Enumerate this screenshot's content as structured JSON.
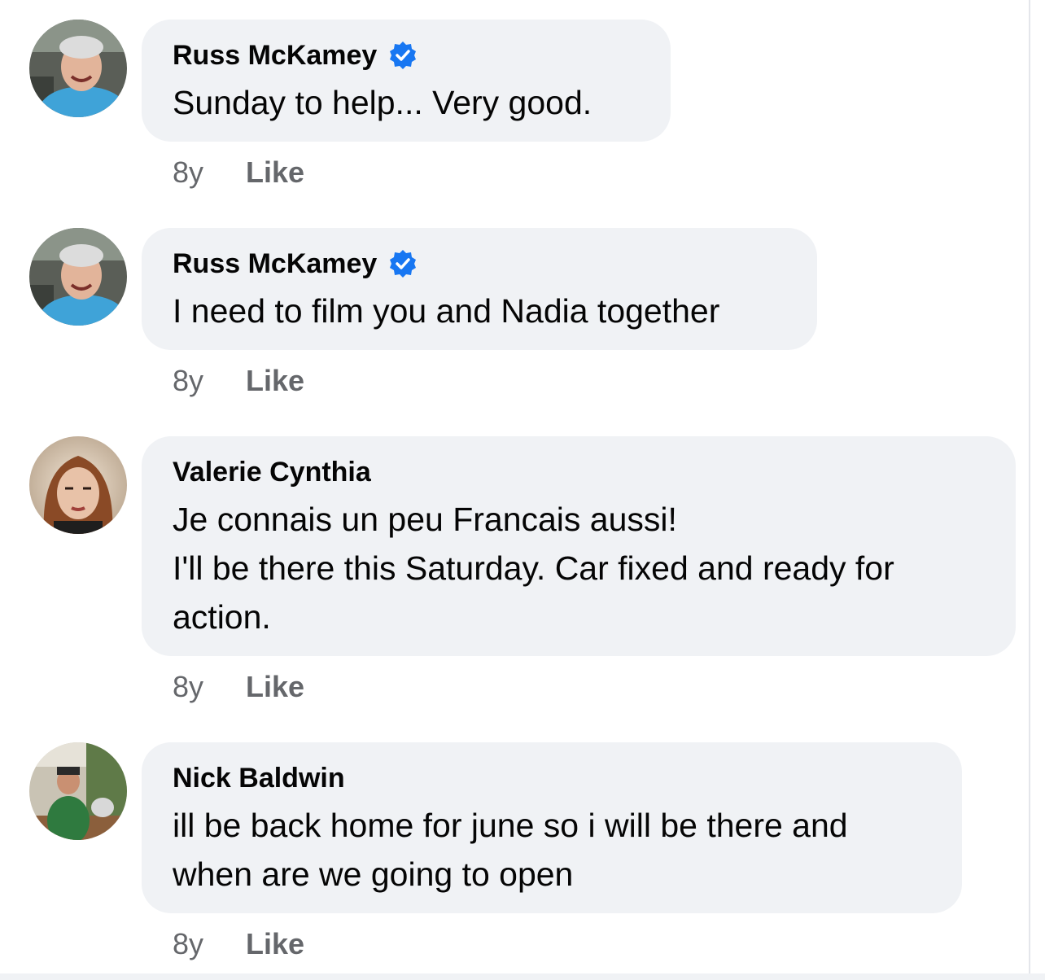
{
  "comments": [
    {
      "author": "Russ McKamey",
      "verified": true,
      "lines": [
        "Sunday to help... Very good."
      ],
      "age": "8y",
      "action": "Like"
    },
    {
      "author": "Russ McKamey",
      "verified": true,
      "lines": [
        "I need to film you and Nadia together"
      ],
      "age": "8y",
      "action": "Like"
    },
    {
      "author": "Valerie Cynthia",
      "verified": false,
      "lines": [
        "Je connais un peu Francais aussi!",
        "I'll be there this Saturday. Car fixed and ready for",
        "action."
      ],
      "age": "8y",
      "action": "Like"
    },
    {
      "author": "Nick Baldwin",
      "verified": false,
      "lines": [
        "ill be back home for june so i will be there and",
        "when are we going to open"
      ],
      "age": "8y",
      "action": "Like"
    }
  ],
  "colors": {
    "bubble": "#f0f2f5",
    "meta_text": "#65676b",
    "verified_badge": "#1877f2"
  },
  "icons": {
    "verified": "verified-badge-icon"
  }
}
